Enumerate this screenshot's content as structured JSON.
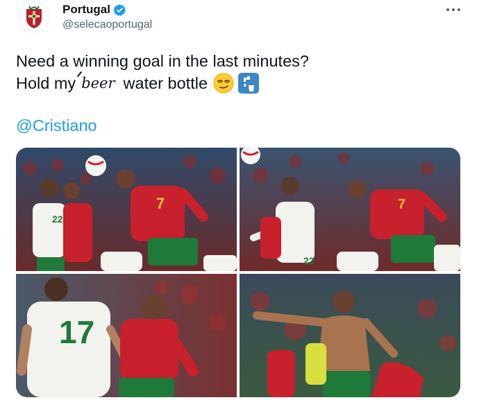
{
  "tweet": {
    "display_name": "Portugal",
    "handle": "@selecaoportugal",
    "verified_icon": "verified-badge-icon",
    "more_icon": "more-horizontal-icon",
    "avatar_icon": "portugal-federation-crest-icon",
    "text_line1": "Need a winning goal in the last minutes?",
    "text_line2_start": "Hold my",
    "struck_word": "beer",
    "text_line2_end": "water bottle",
    "emojis": [
      "smirking-face-emoji",
      "potable-water-emoji"
    ],
    "mention": "@Cristiano"
  },
  "media": {
    "photo_count": 4,
    "jersey_numbers": [
      "22",
      "7",
      "17",
      "22"
    ],
    "colors": {
      "portugal_red": "#c8202c",
      "portugal_green": "#1f7a3a",
      "ireland_white": "#f2f2ee",
      "link_blue": "#1d9bf0",
      "secondary_text": "#536471"
    }
  }
}
